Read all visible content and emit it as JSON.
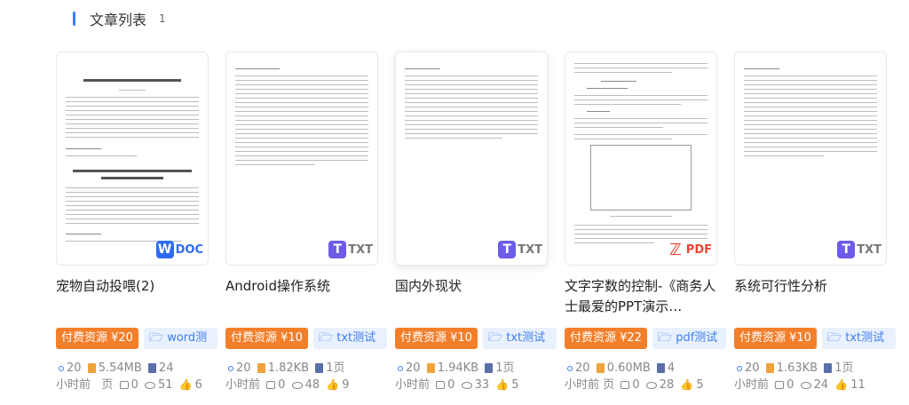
{
  "header": {
    "title": "文章列表",
    "count": "1"
  },
  "cards": [
    {
      "title": "宠物自动投喂(2)",
      "price": "付费资源 ¥20",
      "category": "word测",
      "file_type": "DOC",
      "time_a": "20",
      "time_b": "小时前",
      "size": "5.54MB",
      "pages_a": "24",
      "pages_b": "页",
      "comments": "0",
      "views": "51",
      "likes": "6"
    },
    {
      "title": "Android操作系统",
      "price": "付费资源 ¥10",
      "category": "txt测试",
      "file_type": "TXT",
      "time_a": "20",
      "time_b": "小时前",
      "size": "1.82KB",
      "pages_a": "1页",
      "pages_b": "",
      "comments": "0",
      "views": "48",
      "likes": "9"
    },
    {
      "title": "国内外现状",
      "price": "付费资源 ¥10",
      "category": "txt测试",
      "file_type": "TXT",
      "time_a": "20",
      "time_b": "小时前",
      "size": "1.94KB",
      "pages_a": "1页",
      "pages_b": "",
      "comments": "0",
      "views": "33",
      "likes": "5"
    },
    {
      "title": "文字字数的控制-《商务人士最爱的PPT演示…",
      "price": "付费资源 ¥22",
      "category": "pdf测试",
      "file_type": "PDF",
      "time_a": "20",
      "time_b": "小时前",
      "size": "0.60MB",
      "pages_a": "4",
      "pages_b": "页",
      "comments": "0",
      "views": "28",
      "likes": "5"
    },
    {
      "title": "系统可行性分析",
      "price": "付费资源 ¥10",
      "category": "txt测试",
      "file_type": "TXT",
      "time_a": "20",
      "time_b": "小时前",
      "size": "1.63KB",
      "pages_a": "1页",
      "pages_b": "",
      "comments": "0",
      "views": "24",
      "likes": "11"
    }
  ]
}
